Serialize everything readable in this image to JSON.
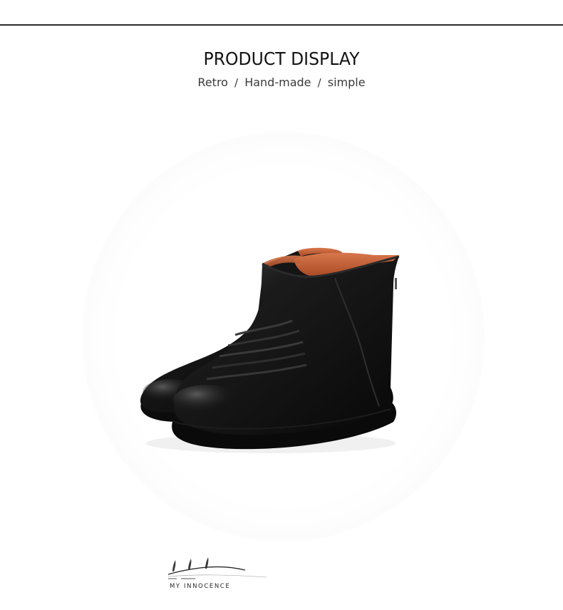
{
  "header": {
    "title": "PRODUCT DISPLAY",
    "tags": [
      "Retro",
      "Hand-made",
      "simple"
    ],
    "separator": "/"
  },
  "product": {
    "image_subject": "black-leather-ankle-boots",
    "colors": {
      "leather": "#141414",
      "lining": "#c4603a",
      "sole": "#0c0c0c"
    }
  },
  "brand": {
    "name": "MY  INNOCENCE",
    "logo_icon": "grass-sprouts-icon"
  }
}
